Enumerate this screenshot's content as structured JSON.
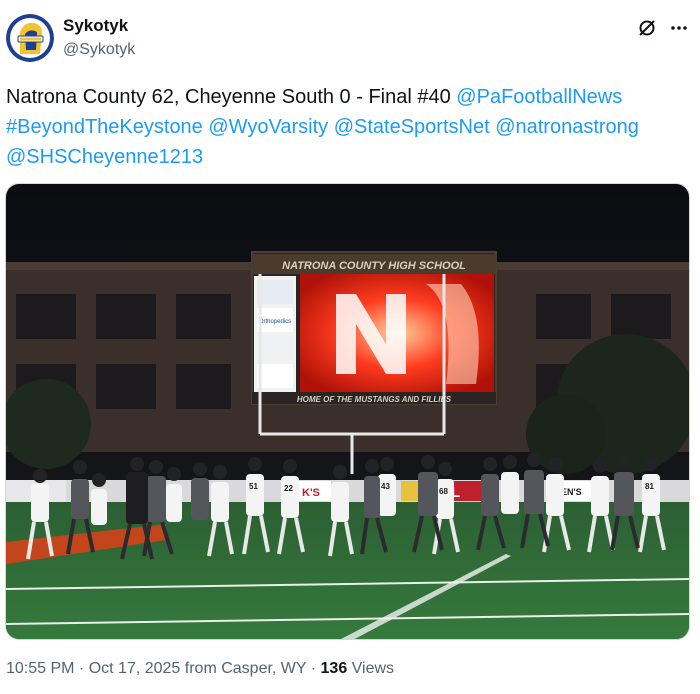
{
  "author": {
    "display_name": "Sykotyk",
    "handle": "@Sykotyk",
    "avatar_icon": "mustang-logo-icon"
  },
  "header_icons": [
    "grok-icon",
    "more-icon"
  ],
  "tweet": {
    "text_plain": "Natrona County 62, Cheyenne South 0 - Final #40 ",
    "mentions": [
      "@PaFootballNews",
      "#BeyondTheKeystone",
      "@WyoVarsity",
      "@StateSportsNet",
      "@natronastrong",
      "@SHSCheyenne1213"
    ]
  },
  "photo": {
    "scoreboard_title": "NATRONA COUNTY HIGH SCHOOL",
    "scoreboard_footer": "HOME OF THE MUSTANGS AND FILLIES",
    "sponsor_label": "Orthopedics",
    "banner_text_1": "PL",
    "banner_text_2": "K'S",
    "banner_text_3": "EN'S",
    "jersey_numbers": [
      "51",
      "22",
      "43",
      "68",
      "81"
    ]
  },
  "meta": {
    "time": "10:55 PM",
    "separator": " · ",
    "date": "Oct 17, 2025",
    "location": " from Casper, WY",
    "views_count": "136",
    "views_label": " Views"
  },
  "colors": {
    "link": "#1d9bf0",
    "text": "#0f1419",
    "secondary": "#536471",
    "field_green": "#2f6d36",
    "avatar_bg": "#1d3f8f",
    "avatar_gold": "#f2c230"
  }
}
